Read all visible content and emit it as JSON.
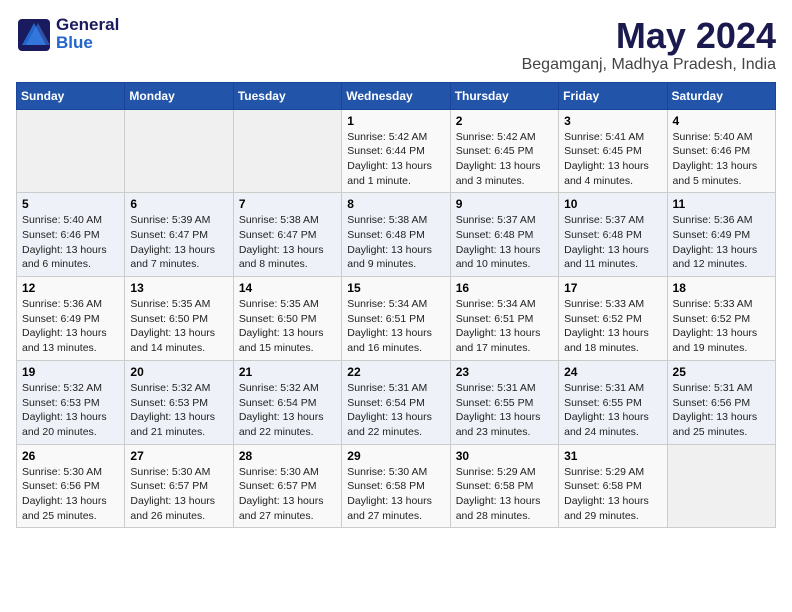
{
  "header": {
    "logo_general": "General",
    "logo_blue": "Blue",
    "title": "May 2024",
    "location": "Begamganj, Madhya Pradesh, India"
  },
  "weekdays": [
    "Sunday",
    "Monday",
    "Tuesday",
    "Wednesday",
    "Thursday",
    "Friday",
    "Saturday"
  ],
  "weeks": [
    [
      {
        "day": "",
        "info": ""
      },
      {
        "day": "",
        "info": ""
      },
      {
        "day": "",
        "info": ""
      },
      {
        "day": "1",
        "info": "Sunrise: 5:42 AM\nSunset: 6:44 PM\nDaylight: 13 hours\nand 1 minute."
      },
      {
        "day": "2",
        "info": "Sunrise: 5:42 AM\nSunset: 6:45 PM\nDaylight: 13 hours\nand 3 minutes."
      },
      {
        "day": "3",
        "info": "Sunrise: 5:41 AM\nSunset: 6:45 PM\nDaylight: 13 hours\nand 4 minutes."
      },
      {
        "day": "4",
        "info": "Sunrise: 5:40 AM\nSunset: 6:46 PM\nDaylight: 13 hours\nand 5 minutes."
      }
    ],
    [
      {
        "day": "5",
        "info": "Sunrise: 5:40 AM\nSunset: 6:46 PM\nDaylight: 13 hours\nand 6 minutes."
      },
      {
        "day": "6",
        "info": "Sunrise: 5:39 AM\nSunset: 6:47 PM\nDaylight: 13 hours\nand 7 minutes."
      },
      {
        "day": "7",
        "info": "Sunrise: 5:38 AM\nSunset: 6:47 PM\nDaylight: 13 hours\nand 8 minutes."
      },
      {
        "day": "8",
        "info": "Sunrise: 5:38 AM\nSunset: 6:48 PM\nDaylight: 13 hours\nand 9 minutes."
      },
      {
        "day": "9",
        "info": "Sunrise: 5:37 AM\nSunset: 6:48 PM\nDaylight: 13 hours\nand 10 minutes."
      },
      {
        "day": "10",
        "info": "Sunrise: 5:37 AM\nSunset: 6:48 PM\nDaylight: 13 hours\nand 11 minutes."
      },
      {
        "day": "11",
        "info": "Sunrise: 5:36 AM\nSunset: 6:49 PM\nDaylight: 13 hours\nand 12 minutes."
      }
    ],
    [
      {
        "day": "12",
        "info": "Sunrise: 5:36 AM\nSunset: 6:49 PM\nDaylight: 13 hours\nand 13 minutes."
      },
      {
        "day": "13",
        "info": "Sunrise: 5:35 AM\nSunset: 6:50 PM\nDaylight: 13 hours\nand 14 minutes."
      },
      {
        "day": "14",
        "info": "Sunrise: 5:35 AM\nSunset: 6:50 PM\nDaylight: 13 hours\nand 15 minutes."
      },
      {
        "day": "15",
        "info": "Sunrise: 5:34 AM\nSunset: 6:51 PM\nDaylight: 13 hours\nand 16 minutes."
      },
      {
        "day": "16",
        "info": "Sunrise: 5:34 AM\nSunset: 6:51 PM\nDaylight: 13 hours\nand 17 minutes."
      },
      {
        "day": "17",
        "info": "Sunrise: 5:33 AM\nSunset: 6:52 PM\nDaylight: 13 hours\nand 18 minutes."
      },
      {
        "day": "18",
        "info": "Sunrise: 5:33 AM\nSunset: 6:52 PM\nDaylight: 13 hours\nand 19 minutes."
      }
    ],
    [
      {
        "day": "19",
        "info": "Sunrise: 5:32 AM\nSunset: 6:53 PM\nDaylight: 13 hours\nand 20 minutes."
      },
      {
        "day": "20",
        "info": "Sunrise: 5:32 AM\nSunset: 6:53 PM\nDaylight: 13 hours\nand 21 minutes."
      },
      {
        "day": "21",
        "info": "Sunrise: 5:32 AM\nSunset: 6:54 PM\nDaylight: 13 hours\nand 22 minutes."
      },
      {
        "day": "22",
        "info": "Sunrise: 5:31 AM\nSunset: 6:54 PM\nDaylight: 13 hours\nand 22 minutes."
      },
      {
        "day": "23",
        "info": "Sunrise: 5:31 AM\nSunset: 6:55 PM\nDaylight: 13 hours\nand 23 minutes."
      },
      {
        "day": "24",
        "info": "Sunrise: 5:31 AM\nSunset: 6:55 PM\nDaylight: 13 hours\nand 24 minutes."
      },
      {
        "day": "25",
        "info": "Sunrise: 5:31 AM\nSunset: 6:56 PM\nDaylight: 13 hours\nand 25 minutes."
      }
    ],
    [
      {
        "day": "26",
        "info": "Sunrise: 5:30 AM\nSunset: 6:56 PM\nDaylight: 13 hours\nand 25 minutes."
      },
      {
        "day": "27",
        "info": "Sunrise: 5:30 AM\nSunset: 6:57 PM\nDaylight: 13 hours\nand 26 minutes."
      },
      {
        "day": "28",
        "info": "Sunrise: 5:30 AM\nSunset: 6:57 PM\nDaylight: 13 hours\nand 27 minutes."
      },
      {
        "day": "29",
        "info": "Sunrise: 5:30 AM\nSunset: 6:58 PM\nDaylight: 13 hours\nand 27 minutes."
      },
      {
        "day": "30",
        "info": "Sunrise: 5:29 AM\nSunset: 6:58 PM\nDaylight: 13 hours\nand 28 minutes."
      },
      {
        "day": "31",
        "info": "Sunrise: 5:29 AM\nSunset: 6:58 PM\nDaylight: 13 hours\nand 29 minutes."
      },
      {
        "day": "",
        "info": ""
      }
    ]
  ]
}
